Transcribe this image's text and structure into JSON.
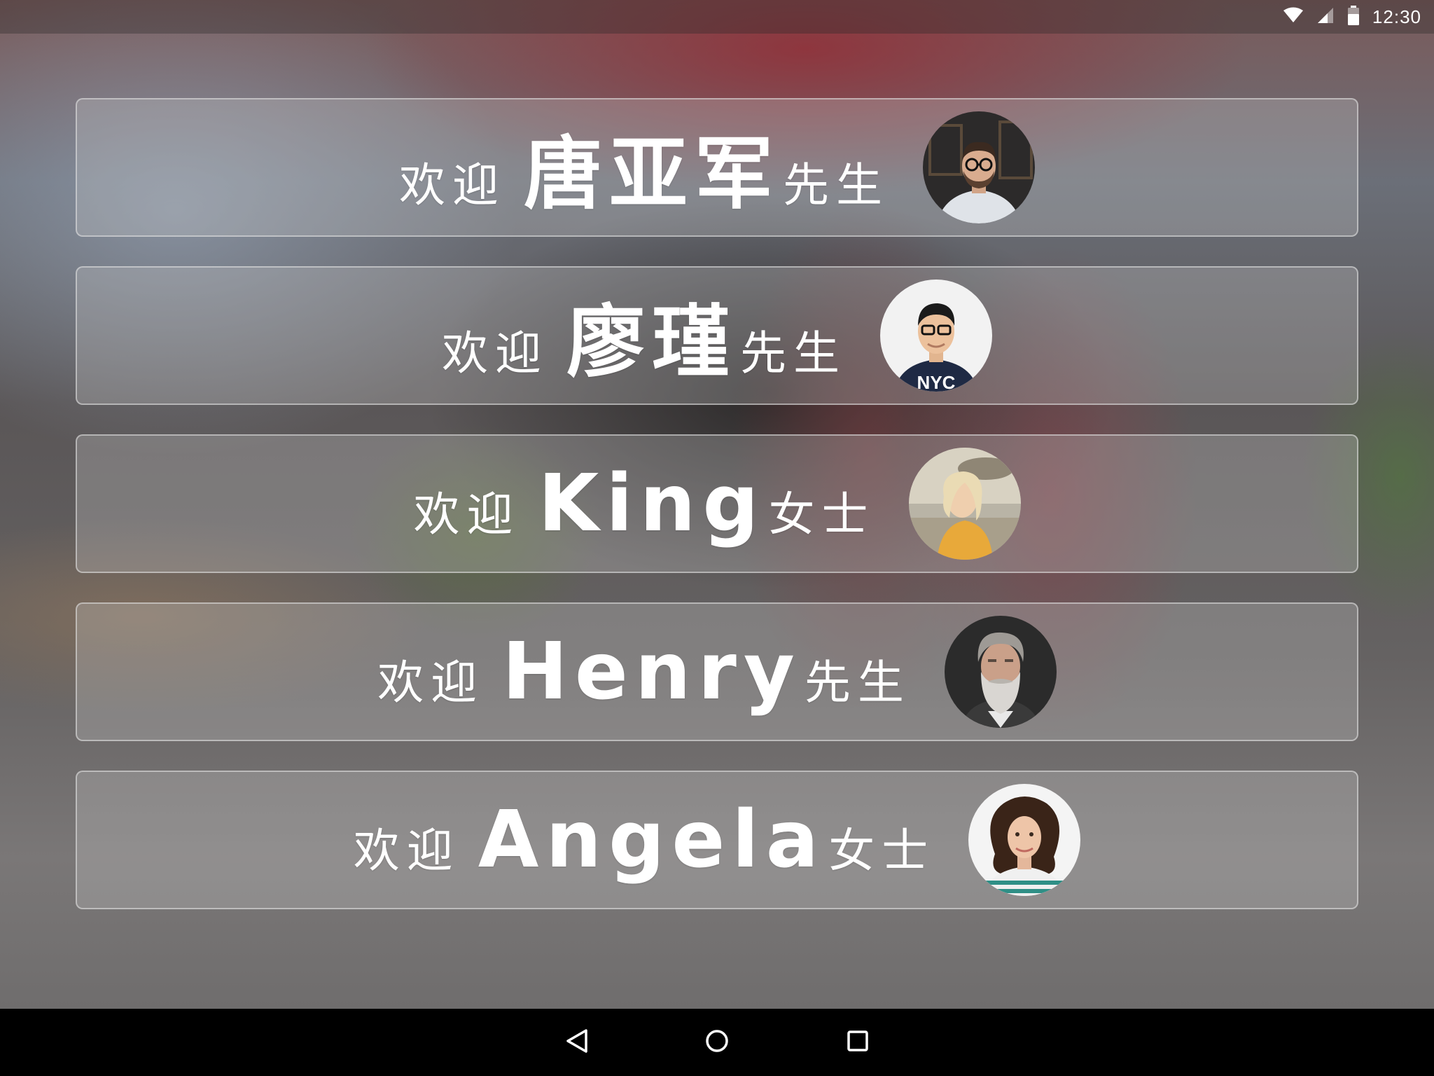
{
  "status_bar": {
    "time": "12:30",
    "icons": [
      "wifi-icon",
      "cell-signal-icon",
      "battery-icon"
    ]
  },
  "welcome_cards": [
    {
      "welcome": "欢迎",
      "name": "唐亚军",
      "honorific": "先生",
      "avatar": "avatar-man-glasses-beard"
    },
    {
      "welcome": "欢迎",
      "name": "廖瑾",
      "honorific": "先生",
      "avatar": "avatar-young-man-glasses"
    },
    {
      "welcome": "欢迎",
      "name": "King",
      "honorific": "女士",
      "avatar": "avatar-woman-blonde"
    },
    {
      "welcome": "欢迎",
      "name": "Henry",
      "honorific": "先生",
      "avatar": "avatar-old-man-beard"
    },
    {
      "welcome": "欢迎",
      "name": "Angela",
      "honorific": "女士",
      "avatar": "avatar-woman-curly-hair"
    }
  ],
  "nav_bar": {
    "buttons": [
      "back-icon",
      "home-icon",
      "recents-icon"
    ]
  },
  "colors": {
    "text": "#ffffff",
    "card_border": "#e6e6e6",
    "nav_bar": "#000000"
  }
}
